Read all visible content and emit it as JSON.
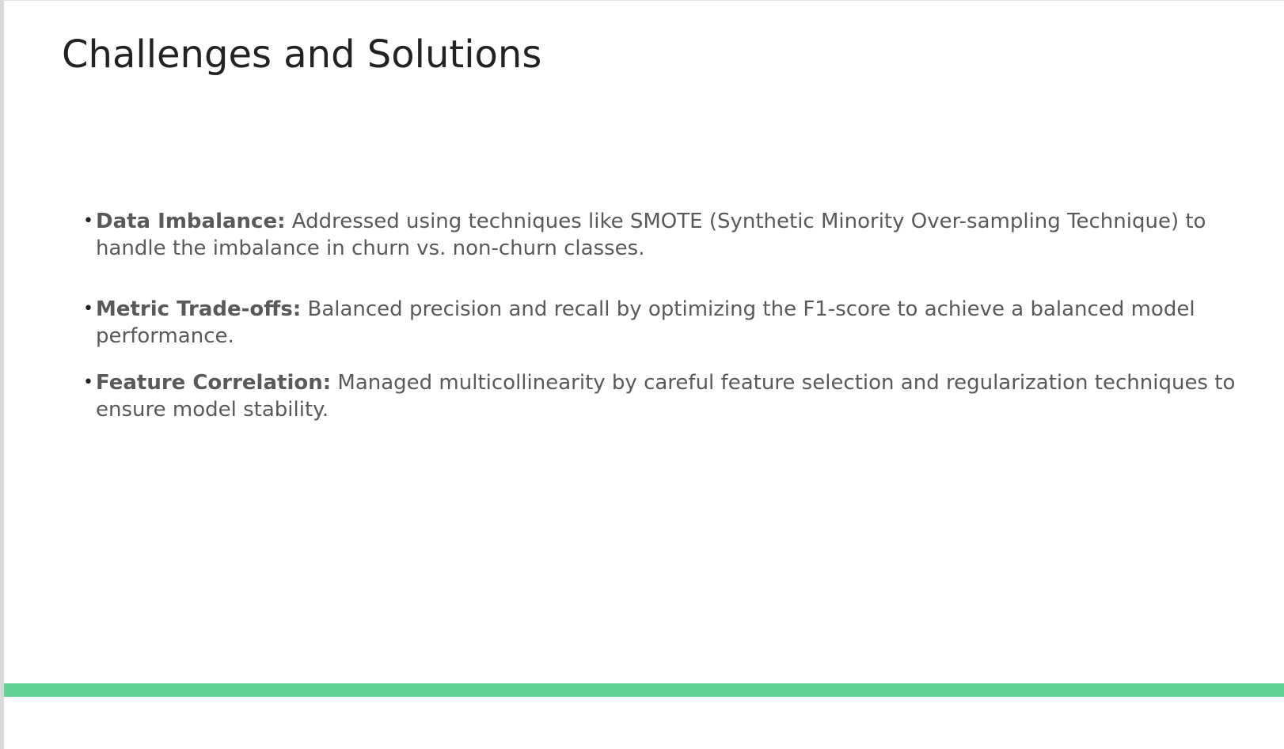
{
  "slide": {
    "title": "Challenges and Solutions",
    "bullets": [
      {
        "term": "Data Imbalance:",
        "text": " Addressed using techniques like SMOTE (Synthetic Minority Over-sampling Technique) to handle the imbalance in churn vs. non-churn classes."
      },
      {
        "term": "Metric Trade-offs:",
        "text": " Balanced precision and recall by optimizing the F1-score to achieve a balanced model performance."
      },
      {
        "term": "Feature Correlation:",
        "text": " Managed multicollinearity by careful feature selection and regularization techniques to ensure model stability."
      }
    ],
    "bullet_glyph": "•"
  },
  "colors": {
    "accent_bar": "#62d296",
    "title_text": "#222222",
    "body_text": "#595959"
  }
}
